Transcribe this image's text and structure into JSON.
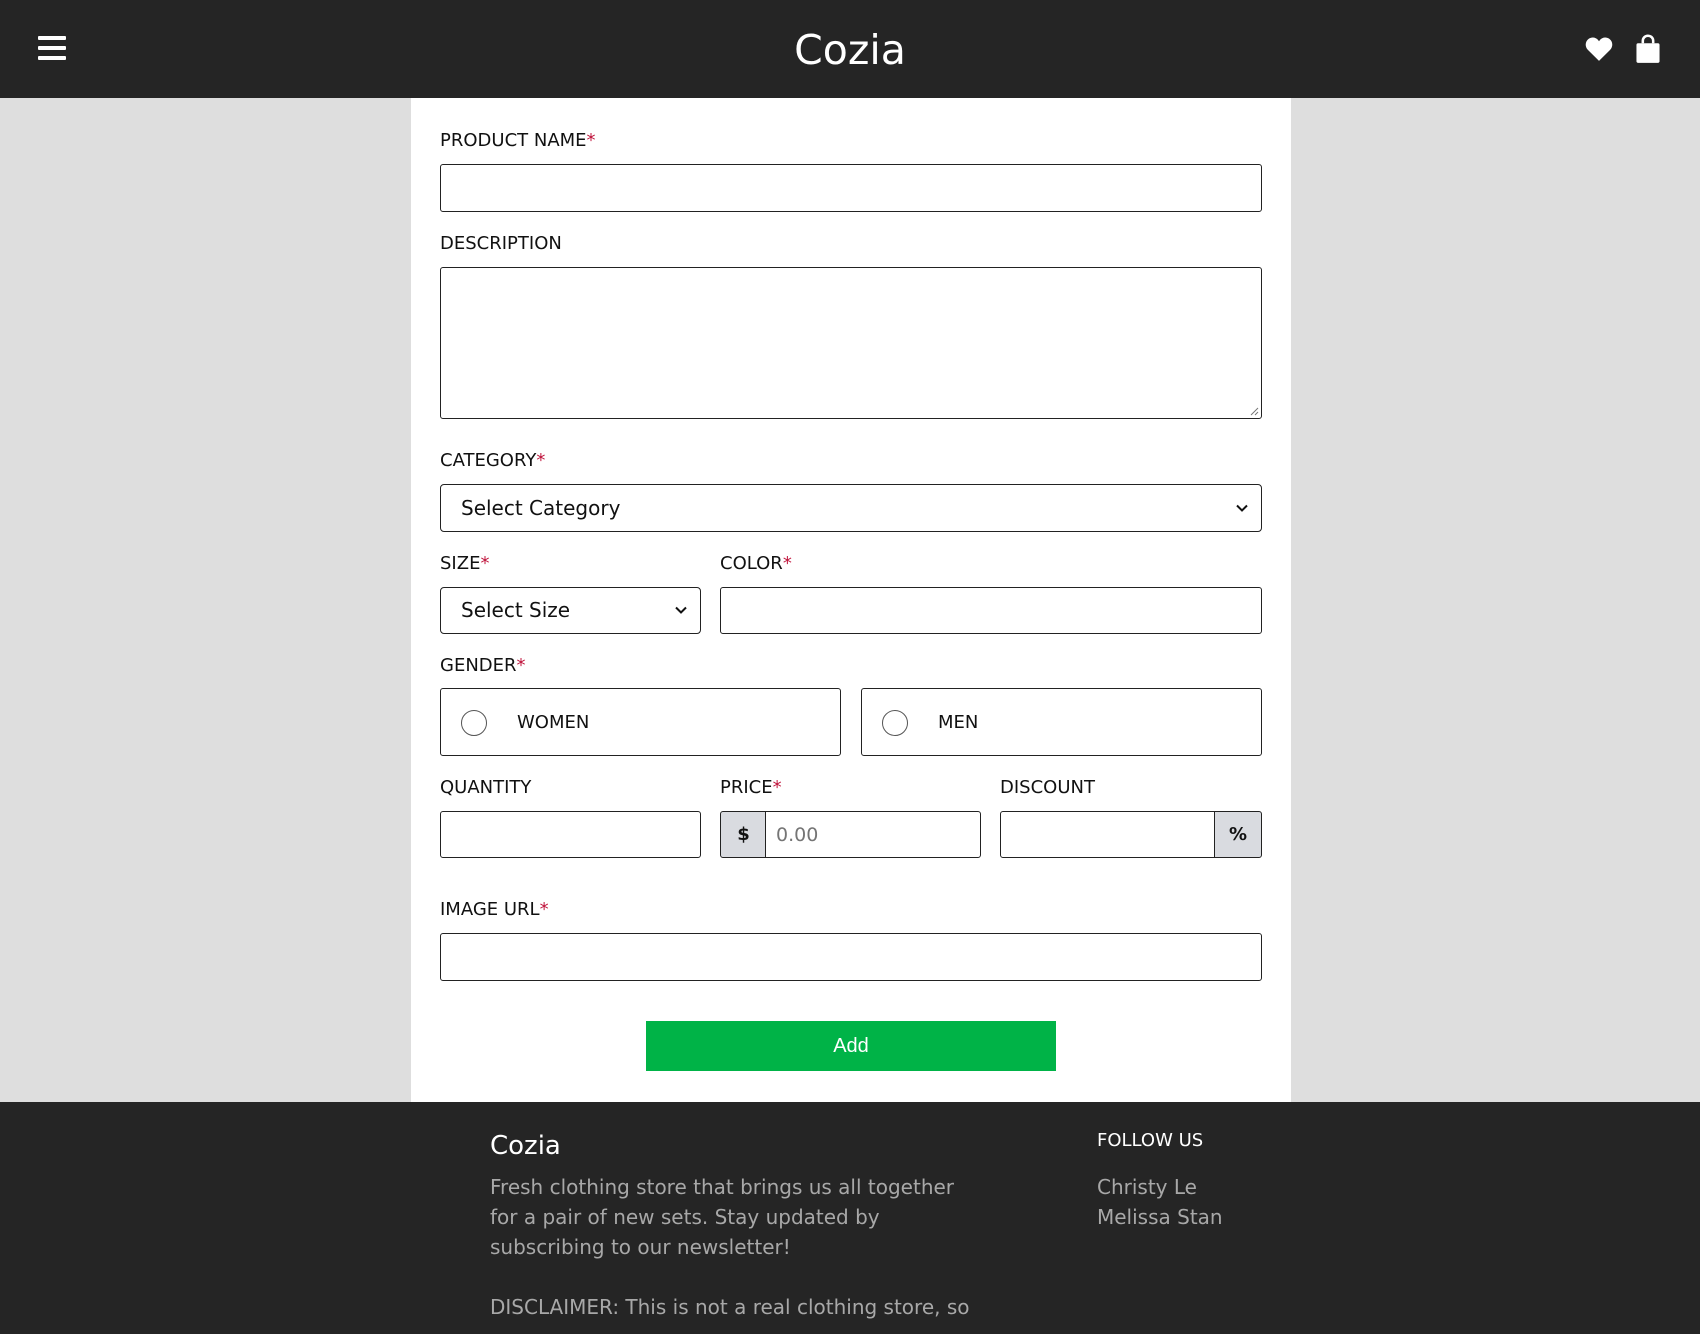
{
  "header": {
    "brand": "Cozia",
    "menu_icon": "hamburger-menu-icon",
    "wishlist_icon": "heart-icon",
    "cart_icon": "shopping-bag-icon"
  },
  "form": {
    "product_name": {
      "label": "PRODUCT NAME",
      "required_mark": "*",
      "value": ""
    },
    "description": {
      "label": "DESCRIPTION",
      "value": ""
    },
    "category": {
      "label": "CATEGORY",
      "required_mark": "*",
      "selected": "Select Category"
    },
    "size": {
      "label": "SIZE",
      "required_mark": "*",
      "selected": "Select Size"
    },
    "color": {
      "label": "COLOR",
      "required_mark": "*",
      "value": ""
    },
    "gender": {
      "label": "GENDER",
      "required_mark": "*",
      "options": [
        {
          "label": "WOMEN"
        },
        {
          "label": "MEN"
        }
      ]
    },
    "quantity": {
      "label": "QUANTITY",
      "value": ""
    },
    "price": {
      "label": "PRICE",
      "required_mark": "*",
      "prefix": "$",
      "placeholder": "0.00"
    },
    "discount": {
      "label": "DISCOUNT",
      "suffix": "%",
      "value": ""
    },
    "image_url": {
      "label": "IMAGE URL",
      "required_mark": "*",
      "value": ""
    },
    "submit_label": "Add"
  },
  "footer": {
    "brand": "Cozia",
    "description": "Fresh clothing store that brings us all together for a pair of new sets. Stay updated by subscribing to our newsletter!",
    "disclaimer": "DISCLAIMER: This is not a real clothing store, so",
    "follow_heading": "FOLLOW US",
    "follow_links": [
      "Christy Le",
      "Melissa Stan"
    ]
  },
  "colors": {
    "header_bg": "#252525",
    "page_bg": "#dedede",
    "required": "#c0143c",
    "submit_bg": "#00b347"
  }
}
